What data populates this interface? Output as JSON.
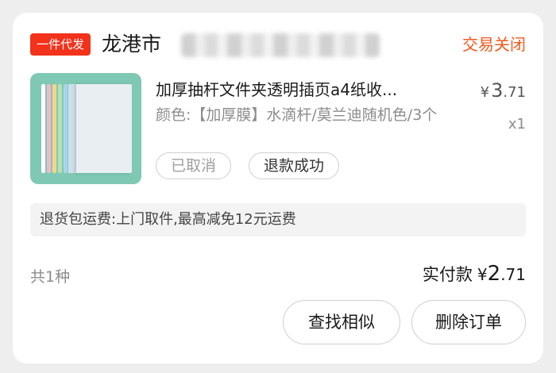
{
  "order": {
    "badge": "一件代发",
    "shop_name": "龙港市",
    "status": "交易关闭"
  },
  "item": {
    "title": "加厚抽杆文件夹透明插页a4纸收...",
    "price_symbol": "¥",
    "price_int": "3",
    "price_dec": ".71",
    "spec": "颜色:【加厚膜】水滴杆/莫兰迪随机色/3个",
    "quantity": "x1",
    "tags": [
      "已取消",
      "退款成功"
    ],
    "thumbnail_colors": [
      "#ffffff",
      "#f2b8c8",
      "#f6d58a",
      "#b8e0b0",
      "#a8d4f0",
      "#c9b6ea",
      "#eaeaea"
    ]
  },
  "policy": "退货包运费:上门取件,最高减免12元运费",
  "summary": {
    "count": "共1种",
    "paid_label": "实付款",
    "paid_symbol": "¥",
    "paid_int": "2",
    "paid_dec": ".71"
  },
  "buttons": {
    "find_similar": "查找相似",
    "delete_order": "删除订单"
  }
}
